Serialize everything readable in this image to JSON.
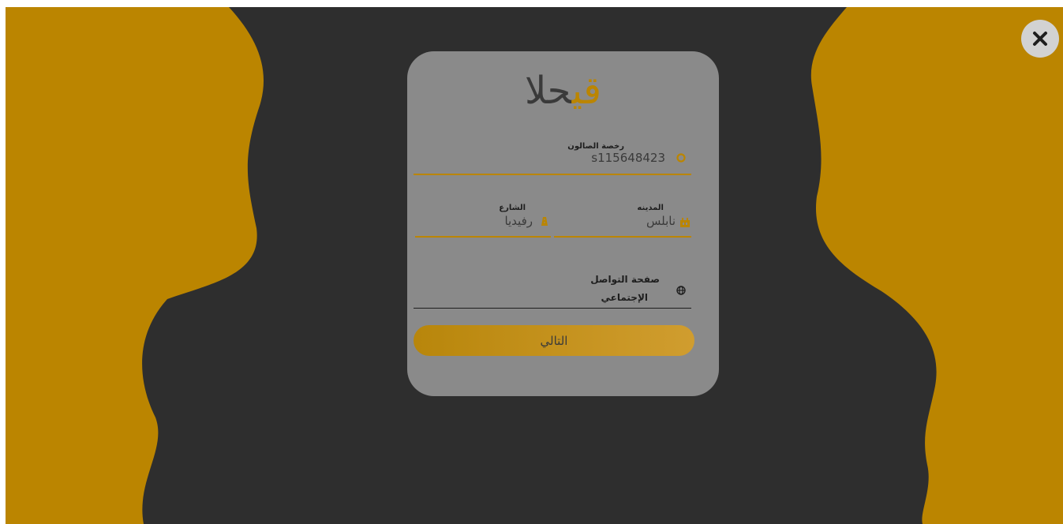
{
  "colors": {
    "background": "#2e2e2e",
    "accent": "#bb8500",
    "card": "#8a8a8a",
    "close_bg": "#d2d2d2"
  },
  "close_button": {
    "icon": "close-icon",
    "glyph": "✕"
  },
  "logo": {
    "part_dark": "حلا",
    "part_accent": "قي"
  },
  "form": {
    "license": {
      "label": "رخصة الصالون",
      "value": "s115648423",
      "icon": "settings-icon"
    },
    "city": {
      "label": "المدينه",
      "value": "نابلس",
      "icon": "city-icon"
    },
    "street": {
      "label": "الشارع",
      "value": "رفيديا",
      "icon": "street-icon"
    },
    "social": {
      "label_line1": "صفحة التواصل",
      "label_line2": "الإجتماعي",
      "icon": "globe-icon"
    }
  },
  "next_button": {
    "label": "التالي"
  }
}
